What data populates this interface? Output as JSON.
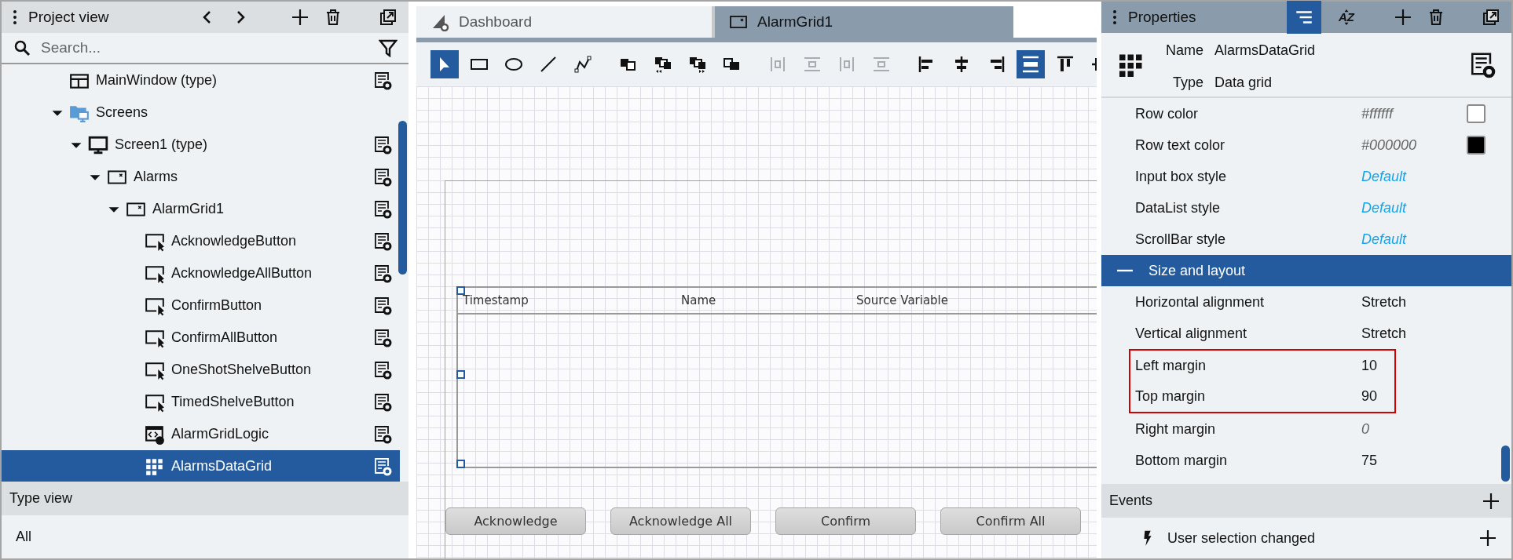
{
  "project_view": {
    "title": "Project view",
    "search": {
      "placeholder": "Search..."
    },
    "tree": [
      {
        "label": "MainWindow (type)",
        "kind": "window",
        "selected": false,
        "properties_button": true
      },
      {
        "label": "Screens",
        "kind": "folder",
        "selected": false,
        "expanded": true,
        "properties_button": false,
        "children": [
          {
            "label": "Screen1 (type)",
            "kind": "screen",
            "selected": false,
            "expanded": true,
            "properties_button": true,
            "children": [
              {
                "label": "Alarms",
                "kind": "panel",
                "selected": false,
                "expanded": true,
                "properties_button": true,
                "children": [
                  {
                    "label": "AlarmGrid1",
                    "kind": "panel",
                    "selected": false,
                    "expanded": true,
                    "properties_button": true,
                    "children": [
                      {
                        "label": "AcknowledgeButton",
                        "kind": "button",
                        "selected": false,
                        "properties_button": true
                      },
                      {
                        "label": "AcknowledgeAllButton",
                        "kind": "button",
                        "selected": false,
                        "properties_button": true
                      },
                      {
                        "label": "ConfirmButton",
                        "kind": "button",
                        "selected": false,
                        "properties_button": true
                      },
                      {
                        "label": "ConfirmAllButton",
                        "kind": "button",
                        "selected": false,
                        "properties_button": true
                      },
                      {
                        "label": "OneShotShelveButton",
                        "kind": "button",
                        "selected": false,
                        "properties_button": true
                      },
                      {
                        "label": "TimedShelveButton",
                        "kind": "button",
                        "selected": false,
                        "properties_button": true
                      },
                      {
                        "label": "AlarmGridLogic",
                        "kind": "logic",
                        "selected": false,
                        "properties_button": true
                      },
                      {
                        "label": "AlarmsDataGrid",
                        "kind": "grid",
                        "selected": true,
                        "properties_button": true
                      }
                    ]
                  }
                ]
              }
            ]
          }
        ]
      }
    ]
  },
  "type_view": {
    "title": "Type view",
    "items": [
      "All"
    ]
  },
  "editor": {
    "tabs": [
      {
        "label": "Dashboard",
        "kind": "dashboard",
        "selected": false
      },
      {
        "label": "AlarmGrid1",
        "kind": "panel",
        "selected": true
      }
    ],
    "toolbar": [
      [
        {
          "kind": "pointer",
          "selected": true,
          "disabled": false
        },
        {
          "kind": "rectangle",
          "selected": false,
          "disabled": false
        },
        {
          "kind": "ellipse",
          "selected": false,
          "disabled": false
        },
        {
          "kind": "line",
          "selected": false,
          "disabled": false
        },
        {
          "kind": "polyline",
          "selected": false,
          "disabled": false
        }
      ],
      [
        {
          "kind": "front",
          "selected": false,
          "disabled": false
        },
        {
          "kind": "forward",
          "selected": false,
          "disabled": false
        },
        {
          "kind": "backward",
          "selected": false,
          "disabled": false
        },
        {
          "kind": "back",
          "selected": false,
          "disabled": false
        }
      ],
      [
        {
          "kind": "dist-h",
          "selected": false,
          "disabled": true
        },
        {
          "kind": "dist-v",
          "selected": false,
          "disabled": true
        },
        {
          "kind": "dist-h",
          "selected": false,
          "disabled": true
        },
        {
          "kind": "dist-v",
          "selected": false,
          "disabled": true
        }
      ],
      [
        {
          "kind": "align-left",
          "selected": false,
          "disabled": false
        },
        {
          "kind": "align-center",
          "selected": false,
          "disabled": false
        },
        {
          "kind": "align-right",
          "selected": false,
          "disabled": false
        },
        {
          "kind": "stretch",
          "selected": true,
          "disabled": false
        },
        {
          "kind": "align-top",
          "selected": false,
          "disabled": false
        },
        {
          "kind": "align-middle",
          "selected": false,
          "disabled": false
        }
      ]
    ],
    "data_grid": {
      "columns": [
        "Timestamp",
        "Name",
        "Source Variable"
      ]
    },
    "buttons": [
      "Acknowledge",
      "Acknowledge All",
      "Confirm",
      "Confirm All"
    ]
  },
  "properties": {
    "title": "Properties",
    "sort_modes": [
      {
        "kind": "categorized",
        "selected": true
      },
      {
        "kind": "alphabetical",
        "label": "AZ",
        "selected": false
      }
    ],
    "name_label": "Name",
    "name": "AlarmsDataGrid",
    "type_label": "Type",
    "type": "Data grid",
    "rows": [
      {
        "kind": "color",
        "label": "Row color",
        "value": "#ffffff",
        "color": "#ffffff",
        "inherited": true,
        "highlighted": false
      },
      {
        "kind": "color",
        "label": "Row text color",
        "value": "#000000",
        "color": "#000000",
        "inherited": true,
        "highlighted": false
      },
      {
        "kind": "style",
        "label": "Input box style",
        "value": "Default",
        "highlighted": false
      },
      {
        "kind": "style",
        "label": "DataList style",
        "value": "Default",
        "highlighted": false
      },
      {
        "kind": "style",
        "label": "ScrollBar style",
        "value": "Default",
        "highlighted": false
      },
      {
        "kind": "section",
        "label": "Size and layout",
        "expanded": true
      },
      {
        "kind": "text",
        "label": "Horizontal alignment",
        "value": "Stretch",
        "inherited": false,
        "highlighted": false
      },
      {
        "kind": "text",
        "label": "Vertical alignment",
        "value": "Stretch",
        "inherited": false,
        "highlighted": false
      },
      {
        "kind": "text",
        "label": "Left margin",
        "value": "10",
        "inherited": false,
        "highlighted": true
      },
      {
        "kind": "text",
        "label": "Top margin",
        "value": "90",
        "inherited": false,
        "highlighted": true
      },
      {
        "kind": "text",
        "label": "Right margin",
        "value": "0",
        "inherited": true,
        "highlighted": false
      },
      {
        "kind": "text",
        "label": "Bottom margin",
        "value": "75",
        "inherited": false,
        "highlighted": false
      }
    ]
  },
  "events": {
    "title": "Events",
    "items": [
      {
        "label": "User selection changed"
      }
    ]
  }
}
